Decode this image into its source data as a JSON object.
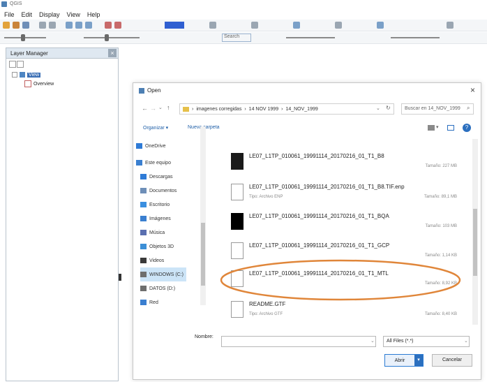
{
  "app": {
    "title": "QGIS"
  },
  "menubar": {
    "items": [
      "File",
      "Edit",
      "Display",
      "View",
      "Help"
    ]
  },
  "toolbar2": {
    "search_placeholder": "Search"
  },
  "layer_manager": {
    "title": "Layer Manager",
    "tree": [
      {
        "label": "View",
        "selected": true
      },
      {
        "label": "Overview",
        "selected": false
      }
    ]
  },
  "dialog": {
    "title": "Open",
    "close_label": "×",
    "breadcrumb": [
      "imagenes corregidas",
      "14 NOV 1999",
      "14_NOV_1999"
    ],
    "search_placeholder": "Buscar en 14_NOV_1999",
    "commands": {
      "organize": "Organizar ▾",
      "new_folder": "Nueva carpeta"
    },
    "nav_items": [
      {
        "label": "OneDrive",
        "icon": "cloud-icon",
        "color": "#2f7bd6"
      },
      {
        "label": "Este equipo",
        "icon": "computer-icon",
        "color": "#3a7fd0"
      },
      {
        "label": "Descargas",
        "icon": "download-icon",
        "color": "#2f7bd6"
      },
      {
        "label": "Documentos",
        "icon": "document-icon",
        "color": "#6e8fb8"
      },
      {
        "label": "Escritorio",
        "icon": "desktop-icon",
        "color": "#3a8fe0"
      },
      {
        "label": "Imágenes",
        "icon": "image-icon",
        "color": "#3a7fd0"
      },
      {
        "label": "Música",
        "icon": "music-icon",
        "color": "#5a6fb0"
      },
      {
        "label": "Objetos 3D",
        "icon": "cube-icon",
        "color": "#3c8fd6"
      },
      {
        "label": "Videos",
        "icon": "video-icon",
        "color": "#3a3a3a"
      },
      {
        "label": "WINDOWS (C:)",
        "icon": "drive-icon",
        "color": "#6e6e6e"
      },
      {
        "label": "DATOS (D:)",
        "icon": "drive-icon",
        "color": "#6e6e6e"
      },
      {
        "label": "Red",
        "icon": "network-icon",
        "color": "#3a7fd0"
      }
    ],
    "files": [
      {
        "name": "LE07_L1TP_010061_19991114_20170216_01_T1_B8",
        "type": "",
        "size": "Tamaño: 227 MB",
        "thumb": "dark"
      },
      {
        "name": "LE07_L1TP_010061_19991114_20170216_01_T1_B8.TIF.enp",
        "type": "Tipo: Archivo ENP",
        "size": "Tamaño: 89,1 MB",
        "thumb": "doc"
      },
      {
        "name": "LE07_L1TP_010061_19991114_20170216_01_T1_BQA",
        "type": "",
        "size": "Tamaño: 103 MB",
        "thumb": "black"
      },
      {
        "name": "LE07_L1TP_010061_19991114_20170216_01_T1_GCP",
        "type": "",
        "size": "Tamaño: 1,14 KB",
        "thumb": "doc"
      },
      {
        "name": "LE07_L1TP_010061_19991114_20170216_01_T1_MTL",
        "type": "",
        "size": "Tamaño: 8,92 KB",
        "thumb": "doc",
        "highlighted": true
      },
      {
        "name": "README.GTF",
        "type": "Tipo: Archivo GTF",
        "size": "Tamaño: 8,40 KB",
        "thumb": "doc"
      }
    ],
    "filename_label": "Nombre:",
    "filename_value": "",
    "filter": "All Files (*.*)",
    "open_label": "Abrir",
    "cancel_label": "Cancelar",
    "highlight_color": "#e0863a"
  }
}
